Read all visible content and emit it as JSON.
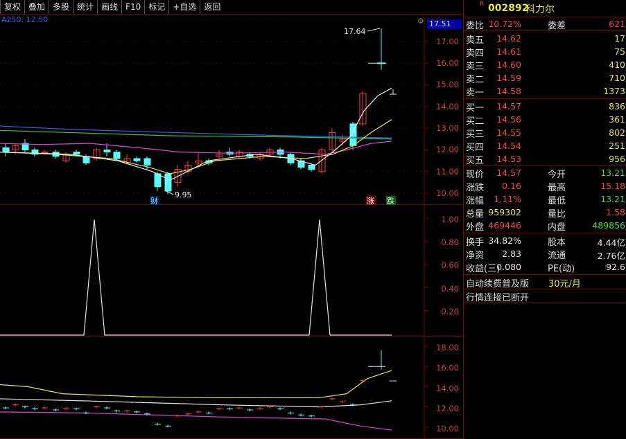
{
  "toolbar": [
    "复权",
    "叠加",
    "多股",
    "统计",
    "画线",
    "F10",
    "标记",
    "+自选",
    "返回"
  ],
  "main_chart": {
    "ma_label": "A250: 12.50",
    "current_price_tag": "17.51",
    "y_ticks": [
      "17.00",
      "16.00",
      "15.00",
      "14.00",
      "13.00",
      "12.00",
      "11.00",
      "10.00"
    ],
    "high_annotation": "17.64",
    "low_annotation": "9.95",
    "markers": [
      "财",
      "涨",
      "跌"
    ]
  },
  "indicator_panel": {
    "y_ticks": [
      "1.00",
      "0.80",
      "0.60",
      "0.40",
      "0.20"
    ]
  },
  "lower_panel": {
    "y_ticks": [
      "18.00",
      "16.00",
      "14.00",
      "12.00",
      "10.00"
    ]
  },
  "stock": {
    "r_mark": "R",
    "code": "002892",
    "name": "科力尔"
  },
  "quote": {
    "weibi_label": "委比",
    "weibi": "10.72%",
    "weicha_label": "委差",
    "weicha": "621",
    "asks": [
      {
        "label": "卖五",
        "price": "14.62",
        "vol": "17"
      },
      {
        "label": "卖四",
        "price": "14.61",
        "vol": "75"
      },
      {
        "label": "卖三",
        "price": "14.60",
        "vol": "410"
      },
      {
        "label": "卖二",
        "price": "14.59",
        "vol": "710"
      },
      {
        "label": "卖一",
        "price": "14.58",
        "vol": "1373"
      }
    ],
    "bids": [
      {
        "label": "买一",
        "price": "14.57",
        "vol": "836"
      },
      {
        "label": "买二",
        "price": "14.56",
        "vol": "361"
      },
      {
        "label": "买三",
        "price": "14.55",
        "vol": "802"
      },
      {
        "label": "买四",
        "price": "14.54",
        "vol": "251"
      },
      {
        "label": "买五",
        "price": "14.53",
        "vol": "956"
      }
    ],
    "stats": [
      {
        "l1": "现价",
        "v1": "14.57",
        "c1": "red",
        "l2": "今开",
        "v2": "13.21",
        "c2": "green"
      },
      {
        "l1": "涨跌",
        "v1": "0.16",
        "c1": "red",
        "l2": "最高",
        "v2": "15.18",
        "c2": "red"
      },
      {
        "l1": "涨幅",
        "v1": "1.11%",
        "c1": "red",
        "l2": "最低",
        "v2": "13.21",
        "c2": "green"
      },
      {
        "l1": "总量",
        "v1": "959302",
        "c1": "yellow",
        "l2": "量比",
        "v2": "1.58",
        "c2": "red"
      },
      {
        "l1": "外盘",
        "v1": "469446",
        "c1": "red",
        "l2": "内盘",
        "v2": "489856",
        "c2": "green"
      }
    ],
    "stats2": [
      {
        "l1": "换手",
        "v1": "34.82%",
        "l2": "股本",
        "v2": "4.44亿"
      },
      {
        "l1": "净资",
        "v1": "2.83",
        "l2": "流通",
        "v2": "2.76亿"
      },
      {
        "l1": "收益(三)",
        "v1": "0.080",
        "l2": "PE(动)",
        "v2": "92.6"
      }
    ],
    "promo_text": "自动续费普及版",
    "promo_price": "30元/月",
    "status": "行情连接已断开"
  },
  "colors": {
    "up": "#ff3b3b",
    "down": "#54ffff",
    "ma_blue": "#3060ff",
    "ma_green": "#30d030",
    "ma_white": "#e6e6e6",
    "ma_yellow": "#e6e633",
    "ma_magenta": "#e040e0",
    "frame": "#7a0000"
  }
}
